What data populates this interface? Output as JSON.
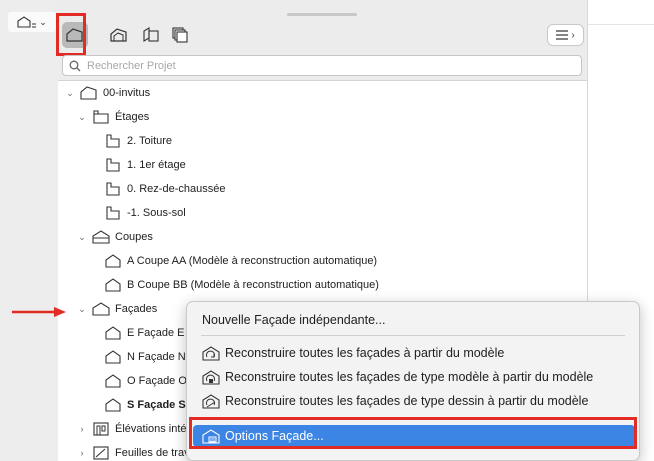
{
  "toolbar": {
    "buttons": [
      {
        "name": "project-map",
        "icon": "house-icon",
        "active": true
      },
      {
        "name": "view-map",
        "icon": "views-icon",
        "active": false
      },
      {
        "name": "layout-book",
        "icon": "layout-icon",
        "active": false
      },
      {
        "name": "publisher-sets",
        "icon": "stack-icon",
        "active": false
      }
    ]
  },
  "search": {
    "placeholder": "Rechercher Projet",
    "value": ""
  },
  "tree": {
    "root": "00-invitus",
    "etages": {
      "label": "Étages",
      "items": [
        "2. Toiture",
        "1. 1er étage",
        "0. Rez-de-chaussée",
        "-1. Sous-sol"
      ]
    },
    "coupes": {
      "label": "Coupes",
      "items": [
        "A Coupe AA (Modèle à reconstruction automatique)",
        "B Coupe BB (Modèle à reconstruction automatique)"
      ]
    },
    "facades": {
      "label": "Façades",
      "items": [
        "E Façade E",
        "N Façade N",
        "O Façade O",
        "S Façade S"
      ]
    },
    "elevations": "Élévations inté",
    "feuilles": "Feuilles de trava"
  },
  "context_menu": {
    "items": [
      {
        "label": "Nouvelle Façade indépendante..."
      },
      {
        "label": "Reconstruire toutes les façades à partir du modèle"
      },
      {
        "label": "Reconstruire toutes les façades de type modèle à partir du modèle"
      },
      {
        "label": "Reconstruire toutes les façades de type dessin à partir du modèle"
      },
      {
        "label": "Options Façade..."
      }
    ]
  },
  "colors": {
    "highlight": "#e32b26",
    "selection": "#3d85e5"
  }
}
